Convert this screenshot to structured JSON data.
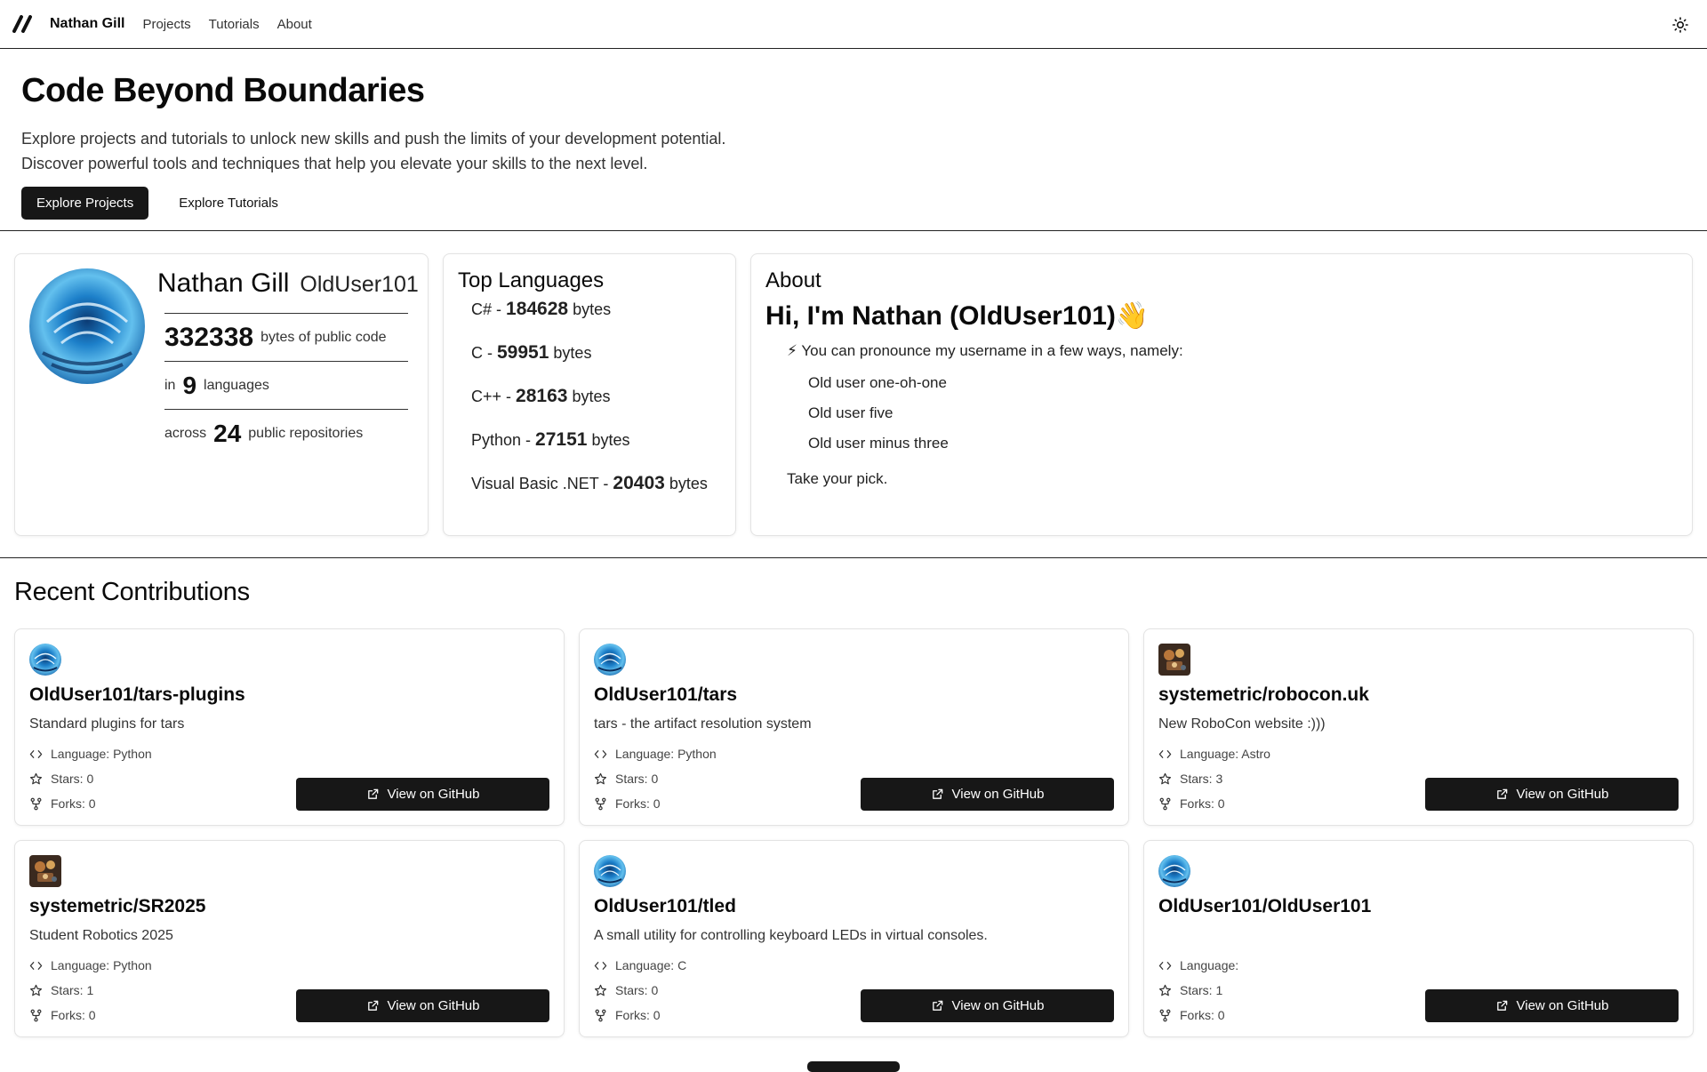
{
  "nav": {
    "brand": "Nathan Gill",
    "links": [
      "Projects",
      "Tutorials",
      "About"
    ],
    "theme_icon": "sun-icon"
  },
  "hero": {
    "title": "Code Beyond Boundaries",
    "line1": "Explore projects and tutorials to unlock new skills and push the limits of your development potential.",
    "line2": "Discover powerful tools and techniques that help you elevate your skills to the next level.",
    "primary_button": "Explore Projects",
    "secondary_button": "Explore Tutorials"
  },
  "profile": {
    "name": "Nathan Gill",
    "username": "OldUser101",
    "bytes": "332338",
    "bytes_label": "bytes of public code",
    "languages_prefix": "in",
    "languages_count": "9",
    "languages_label": "languages",
    "repos_prefix": "across",
    "repos_count": "24",
    "repos_label": "public repositories"
  },
  "top_languages": {
    "title": "Top Languages",
    "unit": "bytes",
    "items": [
      {
        "name": "C#",
        "bytes": "184628"
      },
      {
        "name": "C",
        "bytes": "59951"
      },
      {
        "name": "C++",
        "bytes": "28163"
      },
      {
        "name": "Python",
        "bytes": "27151"
      },
      {
        "name": "Visual Basic .NET",
        "bytes": "20403"
      }
    ]
  },
  "about": {
    "title": "About",
    "greeting": "Hi, I'm Nathan (OldUser101)👋",
    "pronounce": "⚡ You can pronounce my username in a few ways, namely:",
    "options": [
      "Old user one-oh-one",
      "Old user five",
      "Old user minus three"
    ],
    "pick": "Take your pick."
  },
  "contributions": {
    "title": "Recent Contributions",
    "button_label": "View on GitHub",
    "repos": [
      {
        "name": "OldUser101/tars-plugins",
        "desc": "Standard plugins for tars",
        "language": "Language: Python",
        "stars": "Stars: 0",
        "forks": "Forks: 0",
        "avatar": "blue"
      },
      {
        "name": "OldUser101/tars",
        "desc": "tars - the artifact resolution system",
        "language": "Language: Python",
        "stars": "Stars: 0",
        "forks": "Forks: 0",
        "avatar": "blue"
      },
      {
        "name": "systemetric/robocon.uk",
        "desc": "New RoboCon website :)))",
        "language": "Language: Astro",
        "stars": "Stars: 3",
        "forks": "Forks: 0",
        "avatar": "robot"
      },
      {
        "name": "systemetric/SR2025",
        "desc": "Student Robotics 2025",
        "language": "Language: Python",
        "stars": "Stars: 1",
        "forks": "Forks: 0",
        "avatar": "robot"
      },
      {
        "name": "OldUser101/tled",
        "desc": "A small utility for controlling keyboard LEDs in virtual consoles.",
        "language": "Language: C",
        "stars": "Stars: 0",
        "forks": "Forks: 0",
        "avatar": "blue"
      },
      {
        "name": "OldUser101/OldUser101",
        "desc": "",
        "language": "Language:",
        "stars": "Stars: 1",
        "forks": "Forks: 0",
        "avatar": "blue"
      }
    ]
  },
  "colors": {
    "accent": "#171717",
    "border": "#e3e3e3"
  }
}
